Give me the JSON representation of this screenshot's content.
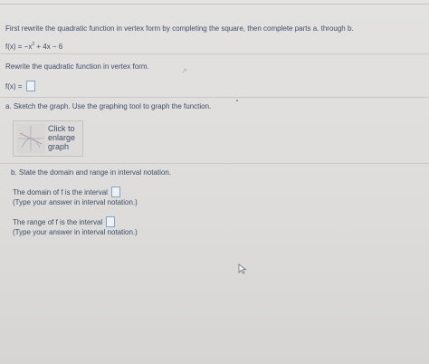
{
  "instructions": "First rewrite the quadratic function in vertex form by completing the square, then complete parts a. through b.",
  "function": {
    "lhs": "f(x) = ",
    "term1": "−x",
    "exp": "2",
    "rest": " + 4x − 6"
  },
  "vertex_form": {
    "prompt": "Rewrite the quadratic function in vertex form.",
    "label": "f(x) ="
  },
  "part_a": {
    "prompt": "a. Sketch the graph. Use the graphing tool to graph the function.",
    "button_lines": [
      "Click to",
      "enlarge",
      "graph"
    ]
  },
  "part_b": {
    "prompt": "b. State the domain and range in interval notation.",
    "domain_label": "The domain of f is the interval",
    "domain_hint": "(Type your answer in interval notation.)",
    "range_label": "The range of f is the interval",
    "range_hint": "(Type your answer in interval notation.)"
  }
}
